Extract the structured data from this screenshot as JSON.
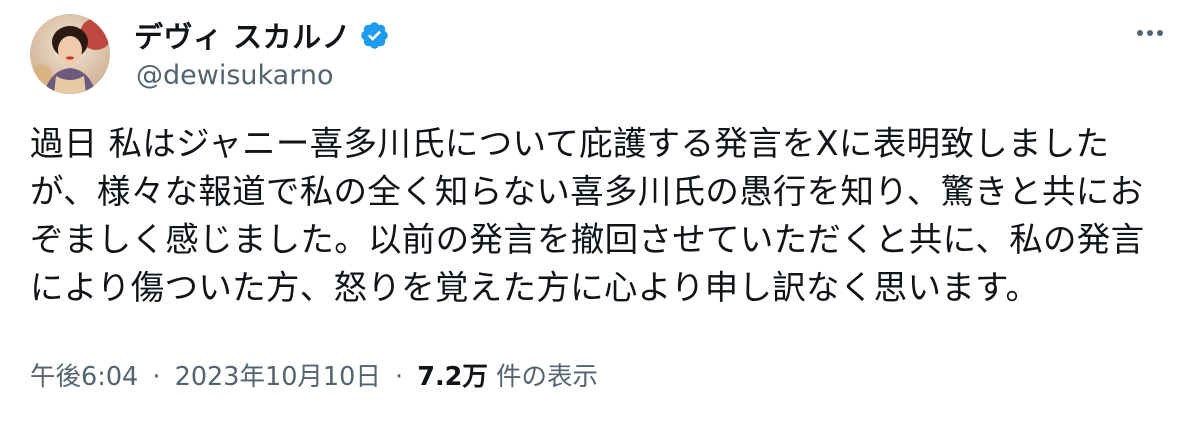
{
  "author": {
    "display_name": "デヴィ スカルノ",
    "handle": "@dewisukarno",
    "verified": true
  },
  "icons": {
    "more": "more-horizontal-icon",
    "verified": "verified-badge-icon"
  },
  "tweet": {
    "body_lines": [
      "過日 私はジャニー喜多川氏について庇護する発言をXに表明致しました",
      "が、様々な報道で私の全く知らない喜多川氏の愚行を知り、驚きと共にお",
      "ぞましく感じました。以前の発言を撤回させていただくと共に、私の発言",
      "により傷ついた方、怒りを覚えた方に心より申し訳なく思います。"
    ],
    "time": "午後6:04",
    "separator": "·",
    "date": "2023年10月10日",
    "views_count": "7.2万",
    "views_label": "件の表示"
  },
  "colors": {
    "text_primary": "#0f1419",
    "text_secondary": "#536471",
    "verified_blue": "#1d9bf0"
  }
}
